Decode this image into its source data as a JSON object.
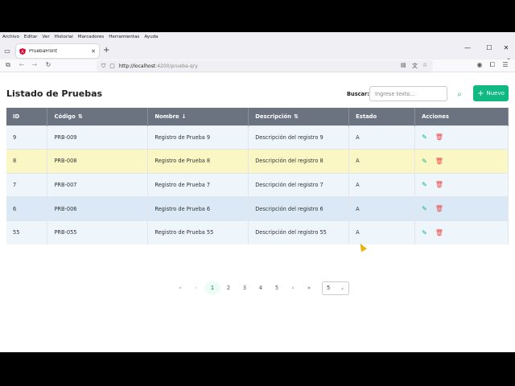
{
  "browser": {
    "menu": [
      "Archivo",
      "Editar",
      "Ver",
      "Historial",
      "Marcadores",
      "Herramientas",
      "Ayuda"
    ],
    "tab_title": "PruebaFront",
    "url_host": "http://localhost",
    "url_rest": ":4200/prueba-qry"
  },
  "page": {
    "title": "Listado de Pruebas",
    "search_label": "Buscar:",
    "search_placeholder": "Ingrese texto...",
    "new_button": "Nuevo"
  },
  "table": {
    "headers": [
      "ID",
      "Código",
      "Nombre",
      "Descripción",
      "Estado",
      "Acciones"
    ],
    "rows": [
      {
        "id": "9",
        "codigo": "PRB-009",
        "nombre": "Registro de Prueba 9",
        "descripcion": "Descripción del registro 9",
        "estado": "A"
      },
      {
        "id": "8",
        "codigo": "PRB-008",
        "nombre": "Registro de Prueba 8",
        "descripcion": "Descripción del registro 8",
        "estado": "A"
      },
      {
        "id": "7",
        "codigo": "PRB-007",
        "nombre": "Registro de Prueba 7",
        "descripcion": "Descripción del registro 7",
        "estado": "A"
      },
      {
        "id": "6",
        "codigo": "PRB-006",
        "nombre": "Registro de Prueba 6",
        "descripcion": "Descripción del registro 6",
        "estado": "A"
      },
      {
        "id": "55",
        "codigo": "PRB-055",
        "nombre": "Registro de Prueba 55",
        "descripcion": "Descripción del registro 55",
        "estado": "A"
      }
    ]
  },
  "pagination": {
    "first": "«",
    "prev": "‹",
    "pages": [
      "1",
      "2",
      "3",
      "4",
      "5"
    ],
    "active_page": "1",
    "next": "›",
    "last": "»",
    "page_size": "5"
  },
  "colors": {
    "accent": "#10b981",
    "header_bg": "#6b7280",
    "highlight_row": "#fbf7c5",
    "hover_row": "#dbe9f6",
    "delete": "#ef4444"
  }
}
